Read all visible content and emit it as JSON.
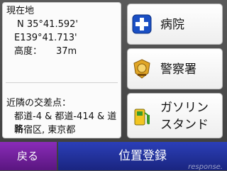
{
  "location": {
    "heading": "現在地",
    "latitude": "N 35°41.592'",
    "longitude": "E139°41.713'",
    "altitude_label": "高度：",
    "altitude_value": "37m"
  },
  "intersection": {
    "heading": "近隣の交差点：",
    "roads": "都道-4 & 都道-414 & 道路",
    "area": "新宿区, 東京都"
  },
  "buttons": {
    "hospital": "病院",
    "police": "警察署",
    "gas_line1": "ガソリン",
    "gas_line2": "スタンド"
  },
  "footer": {
    "back_label": "戻る",
    "save_label": "位置登録"
  },
  "watermark": "response."
}
